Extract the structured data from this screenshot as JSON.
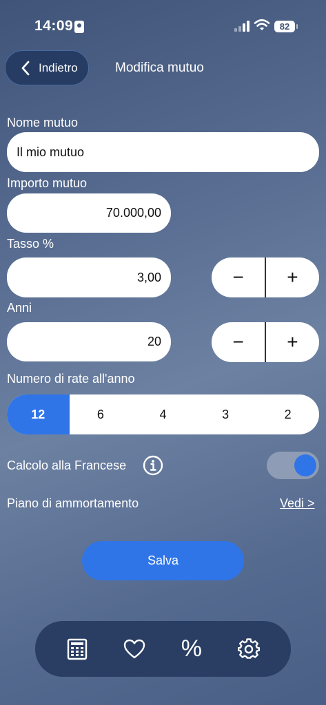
{
  "status_bar": {
    "time": "14:09",
    "battery": "82"
  },
  "header": {
    "back_label": "Indietro",
    "title": "Modifica mutuo"
  },
  "form": {
    "name_label": "Nome mutuo",
    "name_value": "Il mio mutuo",
    "amount_label": "Importo mutuo",
    "amount_value": "70.000,00",
    "rate_label": "Tasso %",
    "rate_value": "3,00",
    "years_label": "Anni",
    "years_value": "20",
    "installments_label": "Numero di rate all'anno",
    "installments_options": [
      "12",
      "6",
      "4",
      "3",
      "2"
    ],
    "installments_selected": "12",
    "french_label": "Calcolo alla Francese",
    "french_enabled": true,
    "amortization_label": "Piano di ammortamento",
    "amortization_link": "Vedi >",
    "stepper_minus": "−",
    "stepper_plus": "+",
    "save_label": "Salva"
  },
  "tabbar": {
    "items": [
      {
        "icon": "calculator-icon"
      },
      {
        "icon": "heart-icon"
      },
      {
        "icon": "percent-icon",
        "glyph": "%"
      },
      {
        "icon": "gear-icon"
      }
    ]
  },
  "colors": {
    "accent": "#2f75e8",
    "tabbar": "#2a3d63",
    "back_button": "#263c63"
  }
}
